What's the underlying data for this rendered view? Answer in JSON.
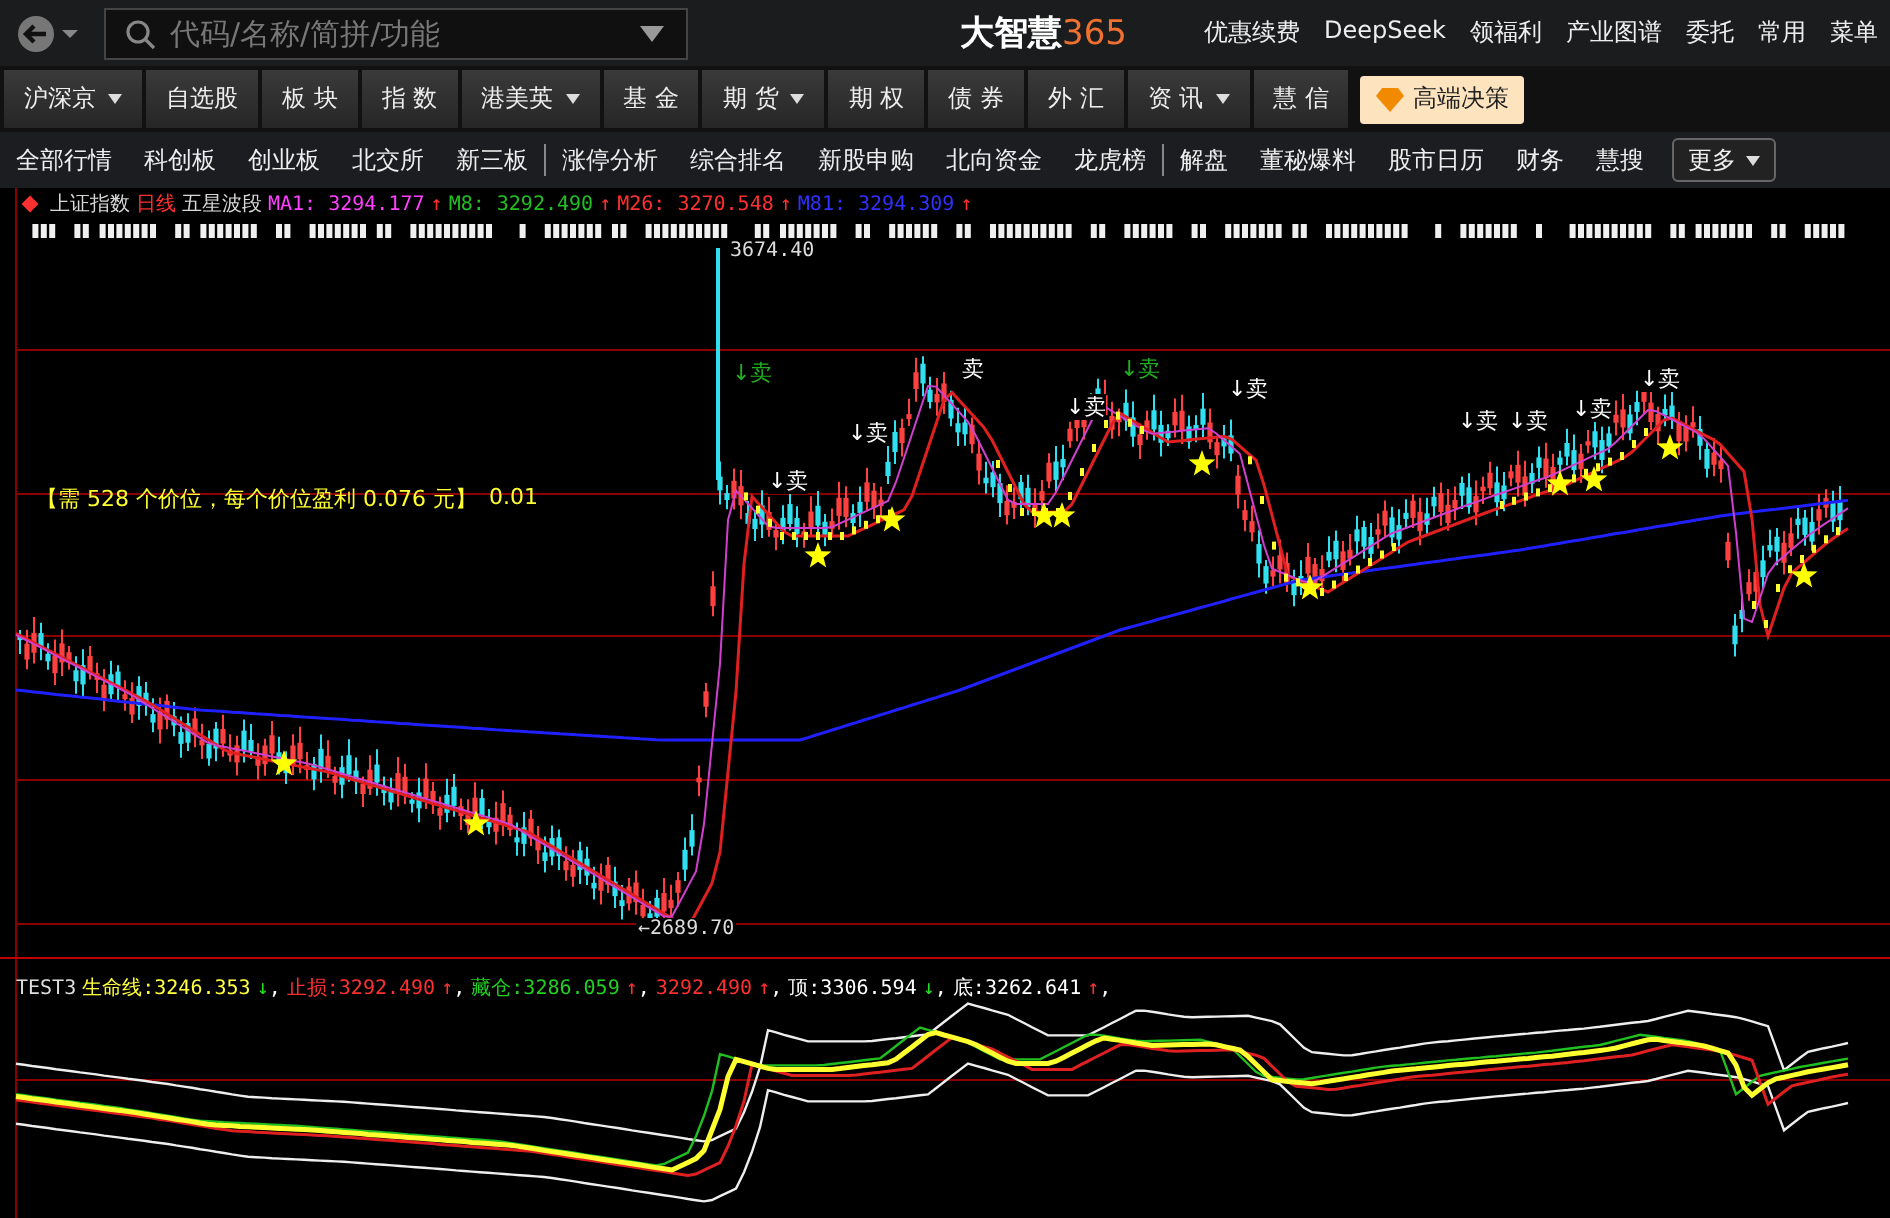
{
  "header": {
    "search": {
      "placeholder": "代码/名称/简拼/功能"
    },
    "logo": {
      "name": "大智慧",
      "accent": "365"
    },
    "links": [
      "优惠续费",
      "DeepSeek",
      "领福利",
      "产业图谱",
      "委托",
      "常用",
      "菜单"
    ]
  },
  "market_tabs": [
    {
      "label": "沪深京",
      "dropdown": true
    },
    {
      "label": "自选股",
      "dropdown": false
    },
    {
      "label": "板 块",
      "dropdown": false
    },
    {
      "label": "指 数",
      "dropdown": false
    },
    {
      "label": "港美英",
      "dropdown": true
    },
    {
      "label": "基 金",
      "dropdown": false
    },
    {
      "label": "期 货",
      "dropdown": true
    },
    {
      "label": "期 权",
      "dropdown": false
    },
    {
      "label": "债 券",
      "dropdown": false
    },
    {
      "label": "外 汇",
      "dropdown": false
    },
    {
      "label": "资 讯",
      "dropdown": true
    },
    {
      "label": "慧 信",
      "dropdown": false
    }
  ],
  "premium_button": "高端决策",
  "sub_tabs": [
    {
      "label": "全部行情",
      "divider_after": false
    },
    {
      "label": "科创板",
      "divider_after": false
    },
    {
      "label": "创业板",
      "divider_after": false
    },
    {
      "label": "北交所",
      "divider_after": false
    },
    {
      "label": "新三板",
      "divider_after": true
    },
    {
      "label": "涨停分析",
      "divider_after": false
    },
    {
      "label": "综合排名",
      "divider_after": false
    },
    {
      "label": "新股申购",
      "divider_after": false
    },
    {
      "label": "北向资金",
      "divider_after": false
    },
    {
      "label": "龙虎榜",
      "divider_after": true
    },
    {
      "label": "解盘",
      "divider_after": false
    },
    {
      "label": "董秘爆料",
      "divider_after": false
    },
    {
      "label": "股市日历",
      "divider_after": false
    },
    {
      "label": "财务",
      "divider_after": false
    },
    {
      "label": "慧搜",
      "divider_after": false
    }
  ],
  "more_button": "更多",
  "chart": {
    "title": [
      {
        "text": "上证指数",
        "color": "#d8d8d8"
      },
      {
        "text": "日线",
        "color": "#ff3030"
      },
      {
        "text": "五星波段",
        "color": "#d8d8d8"
      }
    ],
    "ma_legend": [
      {
        "label": "MA1:",
        "value": "3294.177",
        "color": "#ff40ff",
        "arrow": {
          "text": "↑",
          "color": "#ff3030"
        }
      },
      {
        "label": "M8:",
        "value": "3292.490",
        "color": "#20c020",
        "arrow": {
          "text": "↑",
          "color": "#ff3030"
        }
      },
      {
        "label": "M26:",
        "value": "3270.548",
        "color": "#ff3030",
        "arrow": {
          "text": "↑",
          "color": "#ff3030"
        }
      },
      {
        "label": "M81:",
        "value": "3294.309",
        "color": "#3030ff",
        "arrow": {
          "text": "↑",
          "color": "#ff3030"
        }
      }
    ],
    "high_label": "3674.40",
    "low_label": "←2689.70",
    "note": "【需  528  个价位，每个价位盈利  0.076 元】",
    "note_value": "0.01",
    "sell_marks": [
      {
        "label": "↓卖",
        "color": "#20b020"
      },
      {
        "label": "↓卖",
        "color": "#ffffff"
      },
      {
        "label": "↓卖",
        "color": "#ffffff"
      },
      {
        "label": "卖",
        "color": "#ffffff"
      },
      {
        "label": "↓卖",
        "color": "#ffffff"
      },
      {
        "label": "↓卖",
        "color": "#20b020"
      },
      {
        "label": "↓卖",
        "color": "#ffffff"
      },
      {
        "label": "↓卖",
        "color": "#ffffff"
      },
      {
        "label": "↓卖",
        "color": "#ffffff"
      },
      {
        "label": "↓卖",
        "color": "#ffffff"
      },
      {
        "label": "↓卖",
        "color": "#ffffff"
      }
    ],
    "indicator_name": "TEST3",
    "indicator_legend": [
      {
        "label": "生命线:",
        "value": "3246.353",
        "color": "#ffff40",
        "arrow": {
          "text": "↓",
          "color": "#20e020"
        },
        "separator": ","
      },
      {
        "label": "止损:",
        "value": "3292.490",
        "color": "#ff3030",
        "arrow": {
          "text": "↑",
          "color": "#ff3030"
        },
        "separator": ","
      },
      {
        "label": "藏仓:",
        "value": "3286.059",
        "color": "#20d020",
        "arrow": {
          "text": "↑",
          "color": "#ff3030"
        },
        "separator": ","
      },
      {
        "value": "3292.490",
        "color": "#ff3030",
        "arrow": {
          "text": "↑",
          "color": "#ff3030"
        },
        "separator": ","
      },
      {
        "label": "顶:",
        "value": "3306.594",
        "color": "#ffffff",
        "arrow": {
          "text": "↓",
          "color": "#20e020"
        },
        "separator": ","
      },
      {
        "label": "底:",
        "value": "3262.641",
        "color": "#ffffff",
        "arrow": {
          "text": "↑",
          "color": "#ff3030"
        },
        "separator": ","
      }
    ]
  }
}
